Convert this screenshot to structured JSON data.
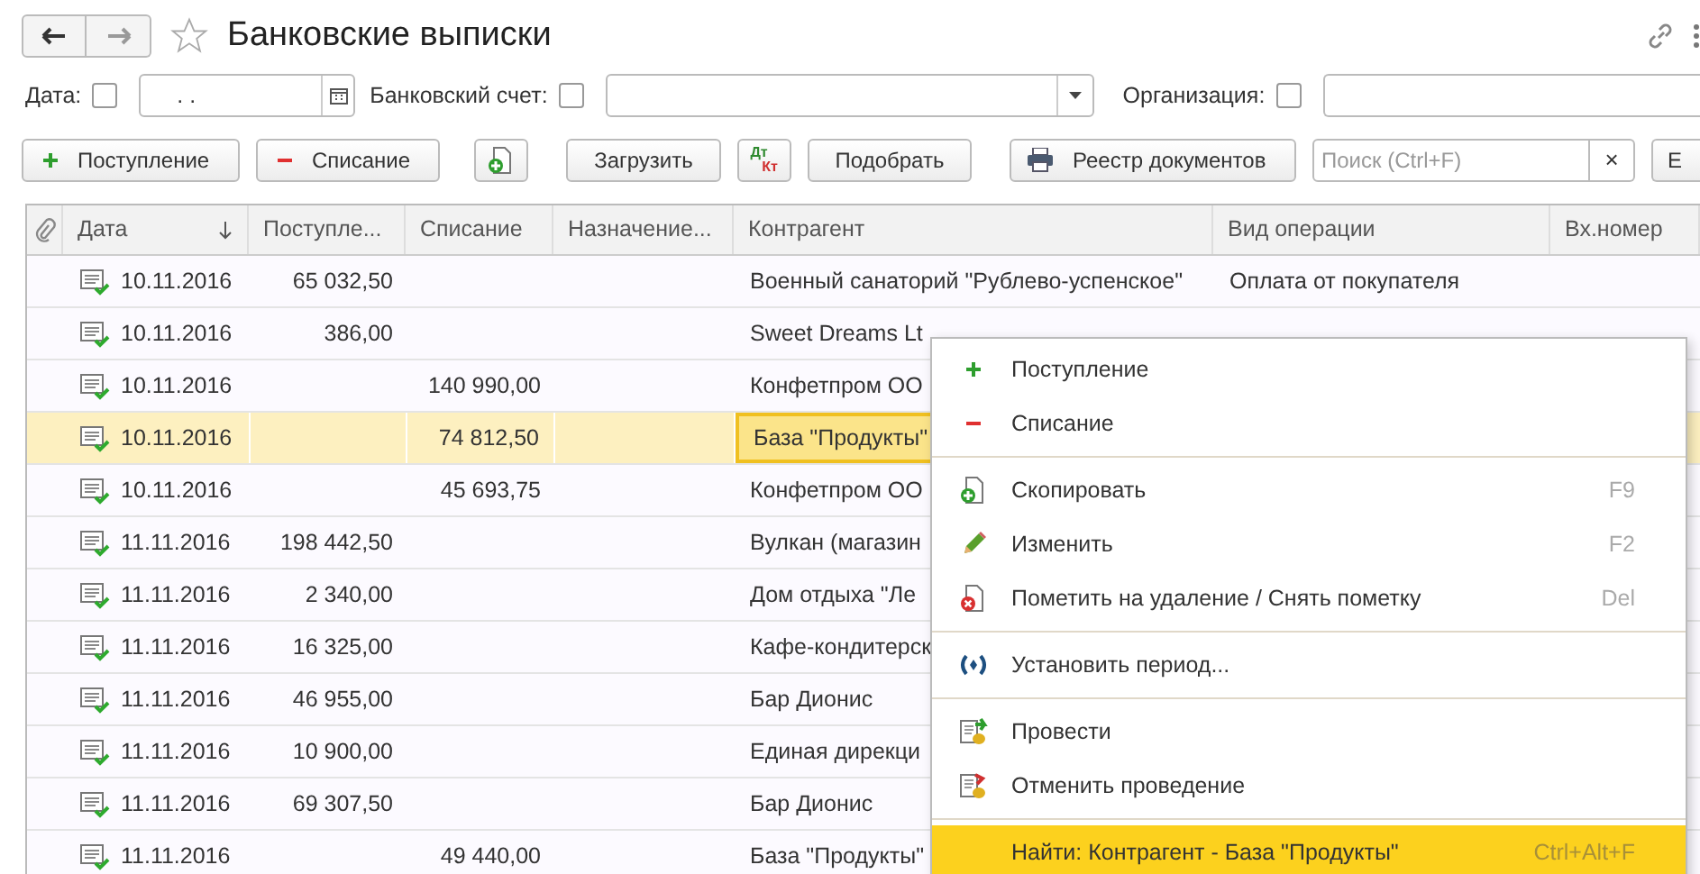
{
  "window": {
    "title": "Банковские выписки",
    "favorite": false
  },
  "filters": [
    {
      "label": "Дата:",
      "checked": false,
      "value": ".  .",
      "kind": "date"
    },
    {
      "label": "Банковский счет:",
      "checked": false,
      "kind": "select"
    },
    {
      "label": "Организация:",
      "checked": false,
      "kind": "text"
    }
  ],
  "toolbar": [
    {
      "kind": "button",
      "label": "Поступление"
    },
    {
      "kind": "button",
      "label": "Списание"
    },
    {
      "kind": "icon"
    },
    {
      "kind": "button",
      "label": "Загрузить"
    },
    {
      "kind": "dtkt",
      "top": "Дт",
      "bottom": "Кт"
    },
    {
      "kind": "button",
      "label": "Подобрать"
    },
    {
      "kind": "button",
      "label": "Реестр документов"
    },
    {
      "kind": "search",
      "placeholder": "Поиск (Ctrl+F)",
      "clear": "×"
    },
    {
      "kind": "button",
      "label": "Е"
    }
  ],
  "table": {
    "columns": [
      {
        "label": "Дата",
        "sorted": true
      },
      {
        "label": "Поступле...",
        "sorted": false
      },
      {
        "label": "Списание",
        "sorted": false
      },
      {
        "label": "Назначение...",
        "sorted": false
      },
      {
        "label": "Контрагент",
        "sorted": false
      },
      {
        "label": "Вид операции",
        "sorted": false
      },
      {
        "label": "Вх.номер",
        "sorted": false
      }
    ],
    "rows": [
      {
        "posted": true,
        "selected": false,
        "cells": [
          "10.11.2016",
          "65 032,50",
          "",
          "",
          "Военный санаторий \"Рублево-успенское\"",
          "Оплата от покупателя"
        ]
      },
      {
        "posted": true,
        "selected": false,
        "cells": [
          "10.11.2016",
          "386,00",
          "",
          "",
          "Sweet Dreams Lt",
          ""
        ]
      },
      {
        "posted": true,
        "selected": false,
        "cells": [
          "10.11.2016",
          "",
          "140 990,00",
          "",
          "Конфетпром ОО",
          ""
        ]
      },
      {
        "posted": true,
        "selected": true,
        "cells": [
          "10.11.2016",
          "",
          "74 812,50",
          "",
          "База \"Продукты\"",
          ""
        ]
      },
      {
        "posted": true,
        "selected": false,
        "cells": [
          "10.11.2016",
          "",
          "45 693,75",
          "",
          "Конфетпром ОО",
          ""
        ]
      },
      {
        "posted": true,
        "selected": false,
        "cells": [
          "11.11.2016",
          "198 442,50",
          "",
          "",
          "Вулкан (магазин",
          ""
        ]
      },
      {
        "posted": true,
        "selected": false,
        "cells": [
          "11.11.2016",
          "2 340,00",
          "",
          "",
          "Дом отдыха \"Ле",
          ""
        ]
      },
      {
        "posted": true,
        "selected": false,
        "cells": [
          "11.11.2016",
          "16 325,00",
          "",
          "",
          "Кафе-кондитерск",
          ""
        ]
      },
      {
        "posted": true,
        "selected": false,
        "cells": [
          "11.11.2016",
          "46 955,00",
          "",
          "",
          "Бар Дионис",
          ""
        ]
      },
      {
        "posted": true,
        "selected": false,
        "cells": [
          "11.11.2016",
          "10 900,00",
          "",
          "",
          "Единая дирекци",
          ""
        ]
      },
      {
        "posted": true,
        "selected": false,
        "cells": [
          "11.11.2016",
          "69 307,50",
          "",
          "",
          "Бар Дионис",
          ""
        ]
      },
      {
        "posted": true,
        "selected": false,
        "cells": [
          "11.11.2016",
          "",
          "49 440,00",
          "",
          "База \"Продукты\"",
          ""
        ]
      }
    ]
  },
  "context_menu": {
    "groups": [
      [
        {
          "label": "Поступление",
          "selected": false
        },
        {
          "label": "Списание",
          "selected": false
        }
      ],
      [
        {
          "label": "Скопировать",
          "shortcut": "F9",
          "selected": false
        },
        {
          "label": "Изменить",
          "shortcut": "F2",
          "selected": false
        },
        {
          "label": "Пометить на удаление / Снять пометку",
          "shortcut": "Del",
          "selected": false
        }
      ],
      [
        {
          "label": "Установить период...",
          "selected": false
        }
      ],
      [
        {
          "label": "Провести",
          "selected": false
        },
        {
          "label": "Отменить проведение",
          "selected": false
        }
      ],
      [
        {
          "label": "Найти: Контрагент - База \"Продукты\"",
          "shortcut": "Ctrl+Alt+F",
          "selected": true
        }
      ]
    ]
  }
}
